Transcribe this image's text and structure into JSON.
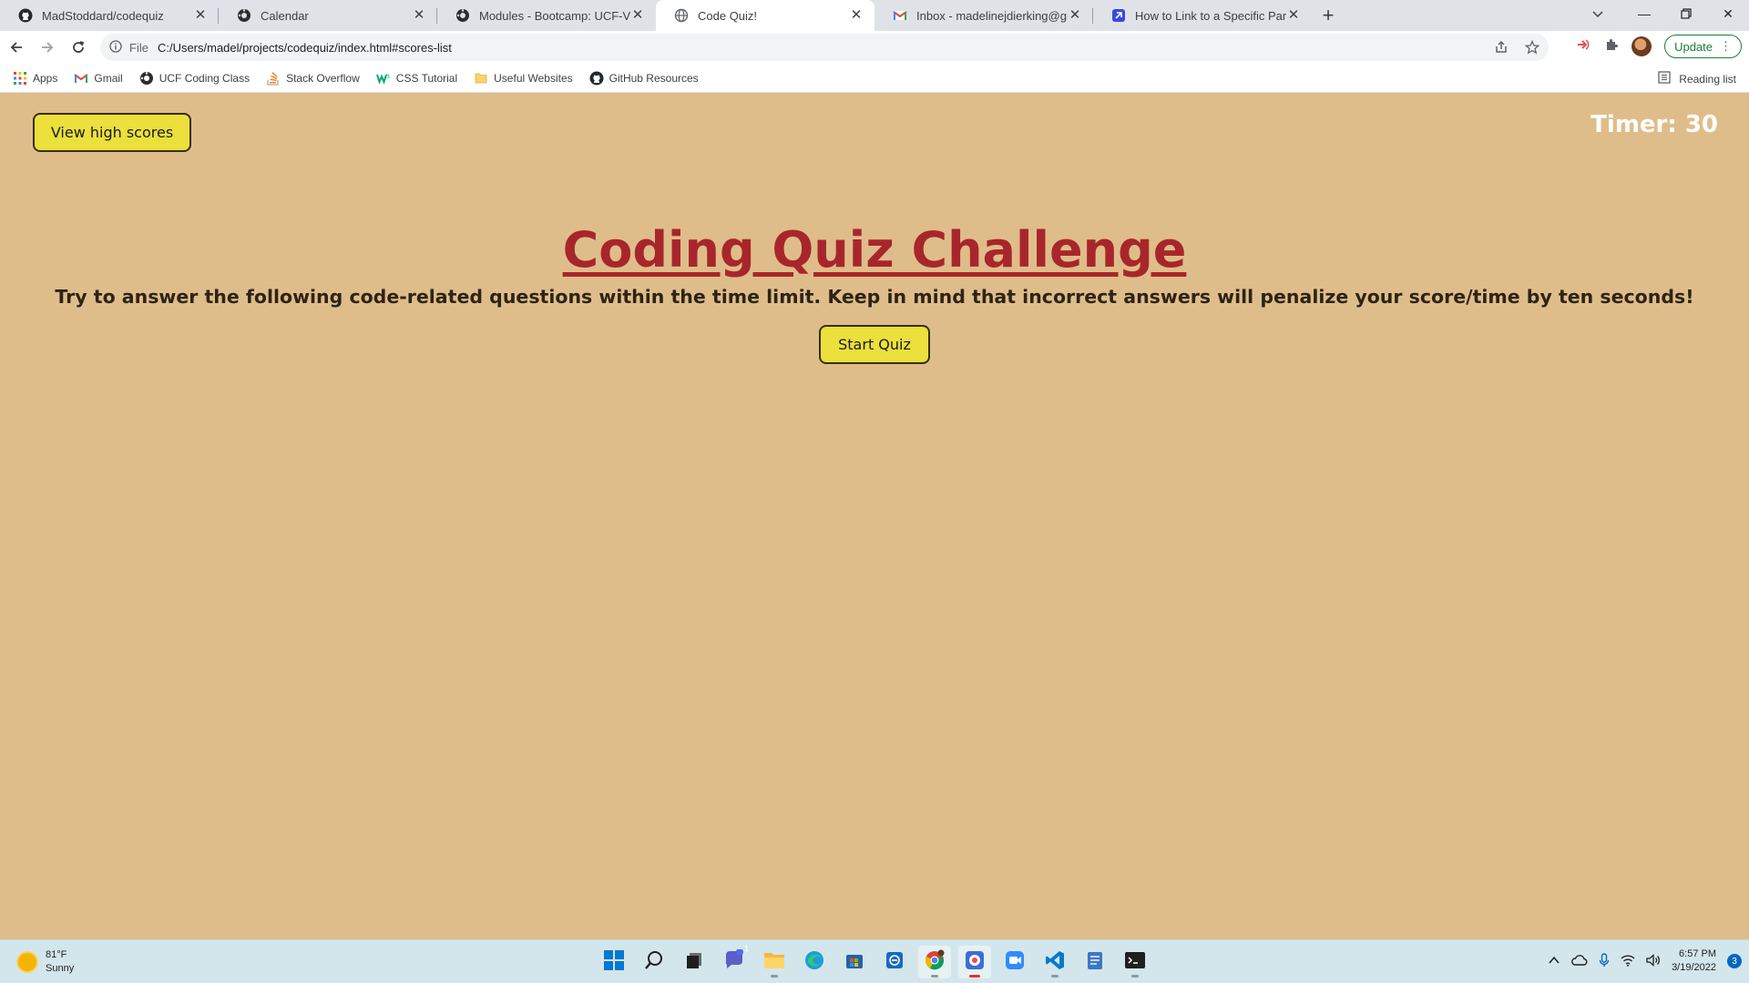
{
  "browser": {
    "tabs": [
      {
        "title": "MadStoddard/codequiz",
        "icon": "github-icon",
        "active": false
      },
      {
        "title": "Calendar",
        "icon": "canvas-icon",
        "active": false
      },
      {
        "title": "Modules - Bootcamp: UCF-VIRT-F",
        "icon": "canvas-icon",
        "active": false
      },
      {
        "title": "Code Quiz!",
        "icon": "globe-icon",
        "active": true
      },
      {
        "title": "Inbox - madelinejdierking@gma",
        "icon": "gmail-icon",
        "active": false
      },
      {
        "title": "How to Link to a Specific Part of",
        "icon": "dev-icon",
        "active": false
      }
    ],
    "new_tab_label": "+",
    "address": {
      "scheme_label": "File",
      "url": "C:/Users/madel/projects/codequiz/index.html#scores-list"
    },
    "update_label": "Update",
    "bookmarks": [
      {
        "label": "Apps",
        "icon": "apps-grid-icon"
      },
      {
        "label": "Gmail",
        "icon": "gmail-icon"
      },
      {
        "label": "UCF Coding Class",
        "icon": "canvas-icon"
      },
      {
        "label": "Stack Overflow",
        "icon": "stackoverflow-icon"
      },
      {
        "label": "CSS Tutorial",
        "icon": "w3schools-icon"
      },
      {
        "label": "Useful Websites",
        "icon": "folder-icon"
      },
      {
        "label": "GitHub Resources",
        "icon": "github-icon"
      }
    ],
    "reading_list_label": "Reading list"
  },
  "page": {
    "view_scores_label": "View high scores",
    "timer_text": "Timer: 30",
    "title": "Coding Quiz Challenge",
    "description": "Try to answer the following code-related questions within the time limit. Keep in mind that incorrect answers will penalize your score/time by ten seconds!",
    "start_label": "Start Quiz"
  },
  "taskbar": {
    "weather_temp": "81°F",
    "weather_desc": "Sunny",
    "time": "6:57 PM",
    "date": "3/19/2022",
    "notification_count": "3",
    "chat_badge": "1"
  },
  "colors": {
    "page_background": "#dfbd8a",
    "button_fill": "#ebe03c",
    "title_color": "#a8262b",
    "timer_color": "#ffffff"
  }
}
